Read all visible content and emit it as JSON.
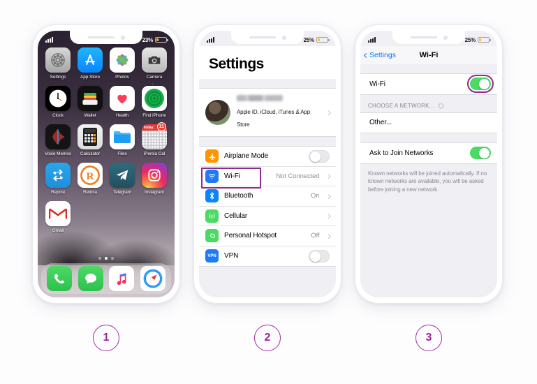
{
  "meta": {
    "accent_purple": "#8e2b8e",
    "ios_blue": "#007aff",
    "toggle_green": "#4cd964",
    "background": "#fdfdfe"
  },
  "phone1": {
    "status": {
      "signal_icon": "cellular-bars-icon",
      "battery_percent": "23%",
      "battery_icon": "battery-icon"
    },
    "apps": [
      {
        "label": "Settings",
        "icon": "settings-gear-icon",
        "selected": true
      },
      {
        "label": "App Store",
        "icon": "app-store-icon",
        "selected": false
      },
      {
        "label": "Photos",
        "icon": "photos-icon",
        "selected": false
      },
      {
        "label": "Camera",
        "icon": "camera-icon",
        "selected": false
      },
      {
        "label": "Clock",
        "icon": "clock-icon",
        "selected": false
      },
      {
        "label": "Wallet",
        "icon": "wallet-icon",
        "selected": false
      },
      {
        "label": "Health",
        "icon": "health-heart-icon",
        "selected": false
      },
      {
        "label": "Find iPhone",
        "icon": "find-iphone-icon",
        "selected": false
      },
      {
        "label": "Voice Memos",
        "icon": "voice-memos-icon",
        "selected": false
      },
      {
        "label": "Calculator",
        "icon": "calculator-icon",
        "selected": false
      },
      {
        "label": "Files",
        "icon": "files-folder-icon",
        "selected": false
      },
      {
        "label": "iPersia Cal",
        "icon": "calendar-icon",
        "selected": false,
        "badge": "11",
        "badge_header": "Today:"
      },
      {
        "label": "Repost",
        "icon": "repost-icon",
        "selected": false
      },
      {
        "label": "Retrica",
        "icon": "retrica-icon",
        "selected": false
      },
      {
        "label": "Telegram",
        "icon": "telegram-icon",
        "selected": false
      },
      {
        "label": "Instagram",
        "icon": "instagram-icon",
        "selected": false
      },
      {
        "label": "Gmail",
        "icon": "gmail-icon",
        "selected": false
      }
    ],
    "page_dots": {
      "count": 3,
      "active_index": 1
    },
    "dock": [
      {
        "label": "Phone",
        "icon": "phone-handset-icon"
      },
      {
        "label": "Messages",
        "icon": "messages-bubble-icon"
      },
      {
        "label": "Music",
        "icon": "music-note-icon"
      },
      {
        "label": "Safari",
        "icon": "safari-compass-icon"
      }
    ]
  },
  "phone2": {
    "status": {
      "signal_icon": "cellular-bars-icon",
      "battery_percent": "25%",
      "battery_icon": "battery-icon"
    },
    "title": "Settings",
    "profile": {
      "name": "A Hossaini",
      "subtitle": "Apple ID, iCloud, iTunes & App Store",
      "avatar": "user-avatar",
      "chevron": "chevron-right-icon"
    },
    "rows": [
      {
        "label": "Airplane Mode",
        "icon": "airplane-icon",
        "control": "toggle",
        "on": false,
        "value": ""
      },
      {
        "label": "Wi-Fi",
        "icon": "wifi-icon",
        "control": "chevron",
        "value": "Not Connected",
        "highlighted": true
      },
      {
        "label": "Bluetooth",
        "icon": "bluetooth-icon",
        "control": "chevron",
        "value": "On"
      },
      {
        "label": "Cellular",
        "icon": "cellular-icon",
        "control": "chevron",
        "value": ""
      },
      {
        "label": "Personal Hotspot",
        "icon": "hotspot-icon",
        "control": "chevron",
        "value": "Off"
      },
      {
        "label": "VPN",
        "icon": "vpn-icon",
        "control": "toggle",
        "on": false,
        "value": ""
      }
    ]
  },
  "phone3": {
    "status": {
      "signal_icon": "cellular-bars-icon",
      "battery_percent": "25%",
      "battery_icon": "battery-icon"
    },
    "nav": {
      "back_label": "Settings",
      "back_icon": "chevron-left-icon",
      "title": "Wi-Fi"
    },
    "wifi_row": {
      "label": "Wi-Fi",
      "on": true,
      "highlighted": true
    },
    "section_header": {
      "label": "CHOOSE A NETWORK...",
      "spinner": "loading-spinner-icon"
    },
    "network_rows": [
      {
        "label": "Other..."
      }
    ],
    "ask_row": {
      "label": "Ask to Join Networks",
      "on": true
    },
    "footnote": "Known networks will be joined automatically. If no known networks are available, you will be asked before joining a new network."
  },
  "steps": [
    {
      "number": "1"
    },
    {
      "number": "2"
    },
    {
      "number": "3"
    }
  ]
}
